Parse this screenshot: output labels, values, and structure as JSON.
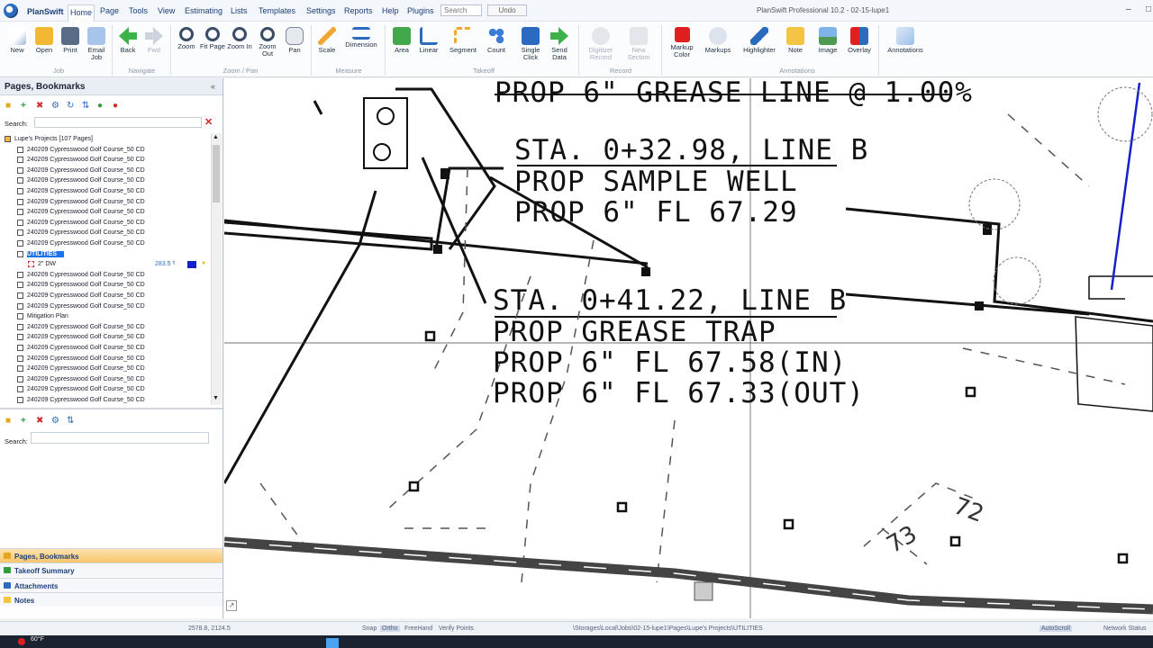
{
  "app": {
    "name": "PlanSwift",
    "window_title": "PlanSwift Professional 10.2 - 02-15-lupe1"
  },
  "menu": [
    "Home",
    "Page",
    "Tools",
    "View",
    "Estimating",
    "Lists",
    "Templates",
    "Settings",
    "Reports",
    "Help",
    "Plugins"
  ],
  "quick": {
    "search_placeholder": "Search",
    "undo": "Undo"
  },
  "ribbon": {
    "buttons": [
      {
        "label": "New",
        "icon": "new-document-icon"
      },
      {
        "label": "Open",
        "icon": "open-folder-icon"
      },
      {
        "label": "Print",
        "icon": "printer-icon"
      },
      {
        "label": "Email Job",
        "icon": "email-icon"
      },
      {
        "label": "Back",
        "icon": "arrow-left-icon"
      },
      {
        "label": "Fwd",
        "icon": "arrow-right-icon"
      },
      {
        "label": "Zoom",
        "icon": "magnifier-icon"
      },
      {
        "label": "Fit Page",
        "icon": "fit-page-icon"
      },
      {
        "label": "Zoom In",
        "icon": "zoom-in-icon"
      },
      {
        "label": "Zoom Out",
        "icon": "zoom-out-icon"
      },
      {
        "label": "Pan",
        "icon": "hand-icon"
      },
      {
        "label": "Scale",
        "icon": "scale-icon"
      },
      {
        "label": "Dimension",
        "icon": "dimension-icon"
      },
      {
        "label": "Area",
        "icon": "area-icon"
      },
      {
        "label": "Linear",
        "icon": "linear-icon"
      },
      {
        "label": "Segment",
        "icon": "segment-icon"
      },
      {
        "label": "Count",
        "icon": "count-icon"
      },
      {
        "label": "Single Click",
        "icon": "single-click-icon"
      },
      {
        "label": "Send Data",
        "icon": "send-data-icon"
      },
      {
        "label": "Digitizer Record",
        "icon": "digitizer-icon"
      },
      {
        "label": "New Section",
        "icon": "new-section-icon"
      },
      {
        "label": "Markup Color",
        "icon": "color-swatch-icon"
      },
      {
        "label": "Markups",
        "icon": "cloud-icon"
      },
      {
        "label": "Highlighter",
        "icon": "highlighter-icon"
      },
      {
        "label": "Note",
        "icon": "note-icon"
      },
      {
        "label": "Image",
        "icon": "image-icon"
      },
      {
        "label": "Overlay",
        "icon": "overlay-icon"
      },
      {
        "label": "Annotations",
        "icon": "annotations-icon"
      }
    ],
    "groups": [
      "Job",
      "Navigate",
      "Zoom / Pan",
      "Measure",
      "Takeoff",
      "Record",
      "Annotations"
    ]
  },
  "left_panel": {
    "title": "Pages, Bookmarks",
    "search_label": "Search:",
    "tree": [
      "Lupe's Projects [107 Pages]",
      "240209 Cypresswood Golf Course_50 CD",
      "240209 Cypresswood Golf Course_50 CD",
      "240209 Cypresswood Golf Course_50 CD",
      "240209 Cypresswood Golf Course_50 CD",
      "240209 Cypresswood Golf Course_50 CD",
      "240209 Cypresswood Golf Course_50 CD",
      "240209 Cypresswood Golf Course_50 CD",
      "240209 Cypresswood Golf Course_50 CD",
      "240209 Cypresswood Golf Course_50 CD",
      "240209 Cypresswood Golf Course_50 CD",
      "UTILITIES",
      "2\" DW",
      "240209 Cypresswood Golf Course_50 CD",
      "240209 Cypresswood Golf Course_50 CD",
      "240209 Cypresswood Golf Course_50 CD",
      "240209 Cypresswood Golf Course_50 CD",
      "Mitigation Plan",
      "240209 Cypresswood Golf Course_50 CD",
      "240209 Cypresswood Golf Course_50 CD",
      "240209 Cypresswood Golf Course_50 CD",
      "240209 Cypresswood Golf Course_50 CD",
      "240209 Cypresswood Golf Course_50 CD",
      "240209 Cypresswood Golf Course_50 CD",
      "240209 Cypresswood Golf Course_50 CD",
      "240209 Cypresswood Golf Course_50 CD"
    ],
    "dw_value": "283.5 ᶠᵗ",
    "search2_label": "Search:",
    "nav": [
      "Pages, Bookmarks",
      "Takeoff Summary",
      "Attachments",
      "Notes"
    ]
  },
  "drawing": {
    "texts": [
      "PROP 6\" GREASE LINE @ 1.00%",
      "STA. 0+32.98, LINE B",
      "PROP SAMPLE WELL",
      "PROP 6\" FL 67.29",
      "STA. 0+41.22, LINE B",
      "PROP GREASE TRAP",
      "PROP 6\" FL 67.58(IN)",
      "PROP 6\" FL 67.33(OUT)",
      "72",
      "73"
    ]
  },
  "status": {
    "coords": "2578.8, 2124.5",
    "snap": "Snap",
    "ortho": "Ortho",
    "freehand": "FreeHand",
    "verify": "Verify Points",
    "path": "\\Storages\\Local\\Jobs\\02-15-lupe1\\Pages\\Lupe's Projects\\UTILITIES",
    "autoscroll": "AutoScroll",
    "network": "Network Status"
  },
  "taskbar": {
    "temp": "60°F"
  },
  "colors": {
    "accent": "#1d3f7a",
    "selection": "#1a73e8",
    "markup_red": "#e02020",
    "dw_blue": "#1520c8"
  }
}
